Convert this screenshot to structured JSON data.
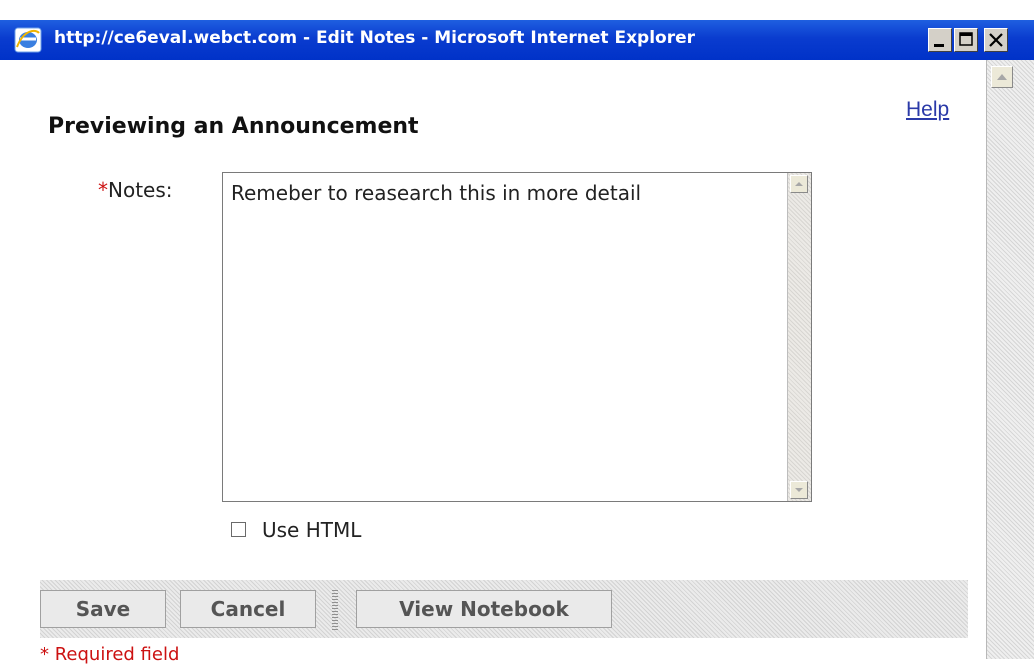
{
  "window": {
    "title": "http://ce6eval.webct.com - Edit Notes - Microsoft Internet Explorer",
    "icon": "ie-icon",
    "controls": [
      "minimize-icon",
      "maximize-icon",
      "close-icon"
    ]
  },
  "page": {
    "help_label": "Help",
    "title": "Previewing an Announcement"
  },
  "form": {
    "required_marker": "*",
    "notes_label": "Notes:",
    "notes_value": "Remeber to reasearch this in more detail",
    "use_html_label": "Use HTML",
    "use_html_checked": false
  },
  "buttons": {
    "save": "Save",
    "cancel": "Cancel",
    "view_notebook": "View Notebook"
  },
  "footer": {
    "required_note": "* Required field"
  },
  "colors": {
    "titlebar": "#0a3ccf",
    "link": "#2b3aa8",
    "required": "#cc1111"
  }
}
